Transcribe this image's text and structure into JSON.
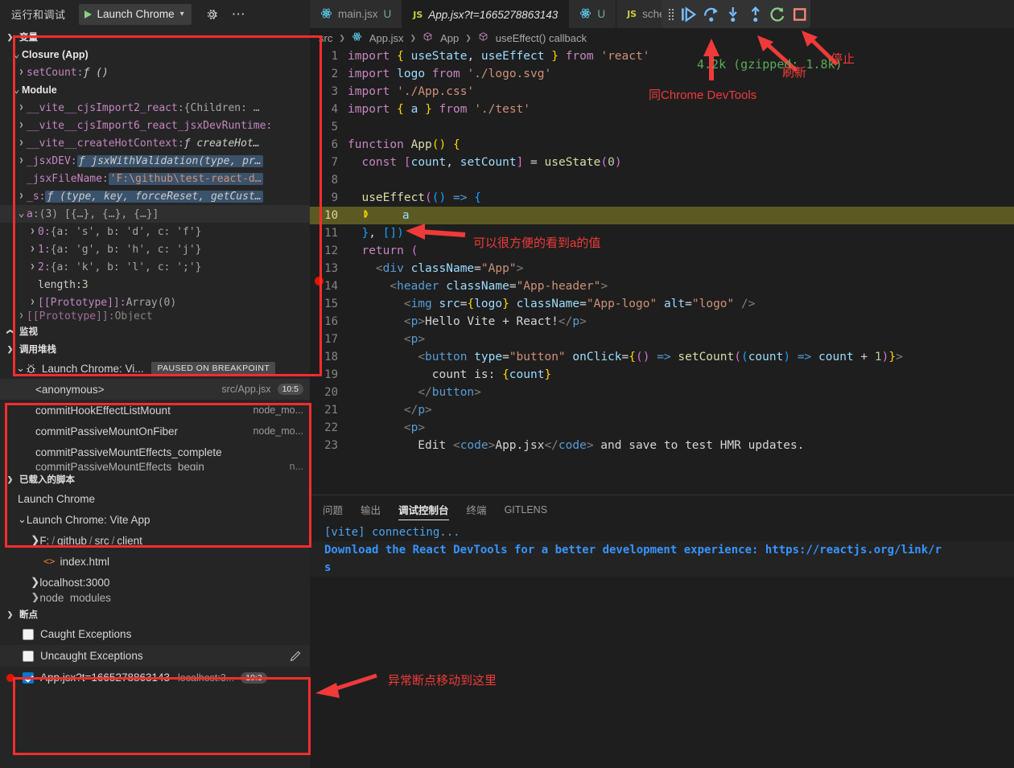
{
  "sidebar": {
    "header_title": "运行和调试",
    "launch_config": "Launch Chrome",
    "gear_icon": "gear-icon",
    "more_icon": "ellipsis-icon",
    "sections": {
      "variables": "变量",
      "watch": "监视",
      "callstack": "调用堆栈",
      "loaded_scripts": "已载入的脚本",
      "breakpoints": "断点"
    },
    "variables": {
      "closure_group": "Closure (App)",
      "closure_items": [
        {
          "name": "setCount:",
          "value": "ƒ ()",
          "kind": "fn",
          "arrow": ">"
        }
      ],
      "module_group": "Module",
      "module_items": [
        {
          "name": "__vite__cjsImport2_react:",
          "value": "{Children: …",
          "kind": "obj",
          "arrow": ">"
        },
        {
          "name": "__vite__cjsImport6_react_jsxDevRuntime:",
          "value": "",
          "kind": "obj",
          "arrow": ">"
        },
        {
          "name": "__vite__createHotContext:",
          "value": "ƒ createHot…",
          "kind": "fn",
          "arrow": ">"
        },
        {
          "name": "_jsxDEV:",
          "value": "ƒ jsxWithValidation(type, pr…",
          "kind": "fn-sel",
          "arrow": ">"
        },
        {
          "name": "_jsxFileName:",
          "value": "'F:\\github\\test-react-d…",
          "kind": "str-sel",
          "arrow": ""
        },
        {
          "name": "_s:",
          "value": "ƒ (type, key, forceReset, getCust…",
          "kind": "fn-sel",
          "arrow": ">"
        }
      ],
      "array_row": {
        "name": "a:",
        "value": "(3) [{…}, {…}, {…}]",
        "arrow": "v"
      },
      "array_children": [
        {
          "name": "0:",
          "value": "{a: 's', b: 'd', c: 'f'}",
          "arrow": ">"
        },
        {
          "name": "1:",
          "value": "{a: 'g', b: 'h', c: 'j'}",
          "arrow": ">"
        },
        {
          "name": "2:",
          "value": "{a: 'k', b: 'l', c: ';'}",
          "arrow": ">"
        },
        {
          "name": "length:",
          "value": "3",
          "arrow": ""
        },
        {
          "name": "[[Prototype]]:",
          "value": "Array(0)",
          "arrow": ">"
        }
      ],
      "cut_row": {
        "name": "[[Prototype]]:",
        "value": "Object",
        "arrow": ">"
      }
    },
    "callstack": {
      "session": "Launch Chrome: Vi...",
      "session_badge": "PAUSED ON BREAKPOINT",
      "frames": [
        {
          "name": "<anonymous>",
          "source": "src/App.jsx",
          "pos": "10:5",
          "selected": true
        },
        {
          "name": "commitHookEffectListMount",
          "source": "node_mo...",
          "pos": "",
          "selected": false
        },
        {
          "name": "commitPassiveMountOnFiber",
          "source": "node_mo...",
          "pos": "",
          "selected": false
        },
        {
          "name": "commitPassiveMountEffects_complete",
          "source": "",
          "pos": "",
          "selected": false
        },
        {
          "name": "commitPassiveMountEffects_begin",
          "source": "n...",
          "pos": "",
          "selected": false
        }
      ]
    },
    "loaded_scripts": [
      {
        "label": "Launch Chrome",
        "indent": 1,
        "arrow": "",
        "icon": ""
      },
      {
        "label": "Launch Chrome: Vite App",
        "indent": 1,
        "arrow": "v",
        "icon": ""
      },
      {
        "label": "F:/github/src/client",
        "indent": 2,
        "arrow": ">",
        "icon": ""
      },
      {
        "label": "index.html",
        "indent": 3,
        "arrow": "",
        "icon": "html-icon"
      },
      {
        "label": "localhost:3000",
        "indent": 2,
        "arrow": ">",
        "icon": ""
      },
      {
        "label": "node_modules",
        "indent": 2,
        "arrow": ">",
        "icon": ""
      }
    ],
    "breakpoints": [
      {
        "label": "Caught Exceptions",
        "checked": false,
        "source": "",
        "pos": "",
        "dot": false,
        "pencil": false
      },
      {
        "label": "Uncaught Exceptions",
        "checked": false,
        "source": "",
        "pos": "",
        "dot": false,
        "pencil": true
      },
      {
        "label": "App.jsx?t=1665278863143",
        "checked": true,
        "source": "localhost:3...",
        "pos": "10:3",
        "dot": true,
        "pencil": false
      }
    ]
  },
  "tabs": [
    {
      "label": "main.jsx",
      "dirty": "U",
      "icon": "react-icon",
      "active": false,
      "italic": false
    },
    {
      "label": "App.jsx?t=1665278863143",
      "dirty": "",
      "icon": "js-icon",
      "active": true,
      "italic": true
    },
    {
      "label": "",
      "dirty": "U",
      "icon": "react-icon",
      "active": false,
      "italic": false
    },
    {
      "label": "scheduler.developmen",
      "dirty": "",
      "icon": "js-icon",
      "active": false,
      "italic": false
    }
  ],
  "debug_toolbar": {
    "drag_handle": "grip-handle",
    "buttons": [
      {
        "name": "continue-button",
        "icon": "continue-icon",
        "color": "#75beff"
      },
      {
        "name": "step-over-button",
        "icon": "step-over-icon",
        "color": "#75beff"
      },
      {
        "name": "step-into-button",
        "icon": "step-into-icon",
        "color": "#75beff"
      },
      {
        "name": "step-out-button",
        "icon": "step-out-icon",
        "color": "#75beff"
      },
      {
        "name": "restart-button",
        "icon": "restart-icon",
        "color": "#89d185"
      },
      {
        "name": "stop-button",
        "icon": "stop-icon",
        "color": "#f48771"
      }
    ]
  },
  "breadcrumb": [
    "src",
    "App.jsx",
    "App",
    "useEffect() callback"
  ],
  "code": {
    "lines": [
      {
        "n": 1,
        "html": "<span class='k'>import</span> <span class='p1'>{</span> <span class='attr'>useState</span>, <span class='attr'>useEffect</span> <span class='p1'>}</span> <span class='k'>from</span> <span class='s'>'react'</span>"
      },
      {
        "n": 2,
        "html": "<span class='k'>import</span> <span class='attr'>logo</span> <span class='k'>from</span> <span class='s'>'./logo.svg'</span>"
      },
      {
        "n": 3,
        "html": "<span class='k'>import</span> <span class='s'>'./App.css'</span>"
      },
      {
        "n": 4,
        "html": "<span class='k'>import</span> <span class='p1'>{</span> <span class='attr'>a</span> <span class='p1'>}</span> <span class='k'>from</span> <span class='s'>'./test'</span>"
      },
      {
        "n": 5,
        "html": ""
      },
      {
        "n": 6,
        "html": "<span class='k'>function</span> <span class='y'>App</span><span class='p1'>()</span> <span class='p1'>{</span>"
      },
      {
        "n": 7,
        "html": "  <span class='k'>const</span> <span class='p2'>[</span><span class='attr'>count</span>, <span class='attr'>setCount</span><span class='p2'>]</span> = <span class='y'>useState</span><span class='p2'>(</span><span class='n'>0</span><span class='p2'>)</span>"
      },
      {
        "n": 8,
        "html": ""
      },
      {
        "n": 9,
        "html": "  <span class='y'>useEffect</span><span class='p2'>(</span><span class='p3'>()</span> <span class='b'>=&gt;</span> <span class='p3'>{</span>"
      },
      {
        "n": 10,
        "html": "    <span class='attr'>a</span>",
        "current": true,
        "debug_arrow": true
      },
      {
        "n": 11,
        "html": "  <span class='p3'>}</span>, <span class='p3'>[])</span>"
      },
      {
        "n": 12,
        "html": "  <span class='k'>return</span> <span class='p2'>(</span>"
      },
      {
        "n": 13,
        "html": "    <span class='g'>&lt;</span><span class='tag'>div</span> <span class='attr'>className</span>=<span class='s'>\"App\"</span><span class='g'>&gt;</span>"
      },
      {
        "n": 14,
        "html": "      <span class='g'>&lt;</span><span class='tag'>header</span> <span class='attr'>className</span>=<span class='s'>\"App-header\"</span><span class='g'>&gt;</span>"
      },
      {
        "n": 15,
        "html": "        <span class='g'>&lt;</span><span class='tag'>img</span> <span class='attr'>src</span>=<span class='p1'>{</span><span class='attr'>logo</span><span class='p1'>}</span> <span class='attr'>className</span>=<span class='s'>\"App-logo\"</span> <span class='attr'>alt</span>=<span class='s'>\"logo\"</span> <span class='g'>/&gt;</span>"
      },
      {
        "n": 16,
        "html": "        <span class='g'>&lt;</span><span class='tag'>p</span><span class='g'>&gt;</span>Hello Vite + React!<span class='g'>&lt;/</span><span class='tag'>p</span><span class='g'>&gt;</span>"
      },
      {
        "n": 17,
        "html": "        <span class='g'>&lt;</span><span class='tag'>p</span><span class='g'>&gt;</span>"
      },
      {
        "n": 18,
        "html": "          <span class='g'>&lt;</span><span class='tag'>button</span> <span class='attr'>type</span>=<span class='s'>\"button\"</span> <span class='attr'>onClick</span>=<span class='p1'>{</span><span class='p2'>()</span> <span class='b'>=&gt;</span> <span class='y'>setCount</span><span class='p2'>(</span><span class='p3'>(</span><span class='attr'>count</span><span class='p3'>)</span> <span class='b'>=&gt;</span> <span class='attr'>count</span> + <span class='n'>1</span><span class='p2'>)</span><span class='p1'>}</span><span class='g'>&gt;</span>"
      },
      {
        "n": 19,
        "html": "            count is: <span class='p1'>{</span><span class='attr'>count</span><span class='p1'>}</span>"
      },
      {
        "n": 20,
        "html": "          <span class='g'>&lt;/</span><span class='tag'>button</span><span class='g'>&gt;</span>"
      },
      {
        "n": 21,
        "html": "        <span class='g'>&lt;/</span><span class='tag'>p</span><span class='g'>&gt;</span>"
      },
      {
        "n": 22,
        "html": "        <span class='g'>&lt;</span><span class='tag'>p</span><span class='g'>&gt;</span>"
      },
      {
        "n": 23,
        "html": "          Edit <span class='g'>&lt;</span><span class='tag'>code</span><span class='g'>&gt;</span>App.jsx<span class='g'>&lt;/</span><span class='tag'>code</span><span class='g'>&gt;</span> and save to test HMR updates."
      }
    ]
  },
  "panel": {
    "tabs": [
      {
        "label": "问题",
        "active": false
      },
      {
        "label": "输出",
        "active": false
      },
      {
        "label": "调试控制台",
        "active": true
      },
      {
        "label": "终端",
        "active": false
      },
      {
        "label": "GITLENS",
        "active": false
      }
    ],
    "console": [
      {
        "text": "[vite] connecting...",
        "style": "vite"
      },
      {
        "text": "Download the React DevTools for a better development experience: https://reactjs.org/link/r",
        "style": "devt"
      },
      {
        "text": "s",
        "style": "devt"
      }
    ]
  },
  "annotations": {
    "import_cost": "4.2k (gzipped: 1.8k)",
    "devtools_note": "同Chrome DevTools",
    "refresh_label": "刷新",
    "stop_label": "停止",
    "inline_value_note": "可以很方便的看到a的值",
    "breakpoint_note": "异常断点移动到这里"
  }
}
